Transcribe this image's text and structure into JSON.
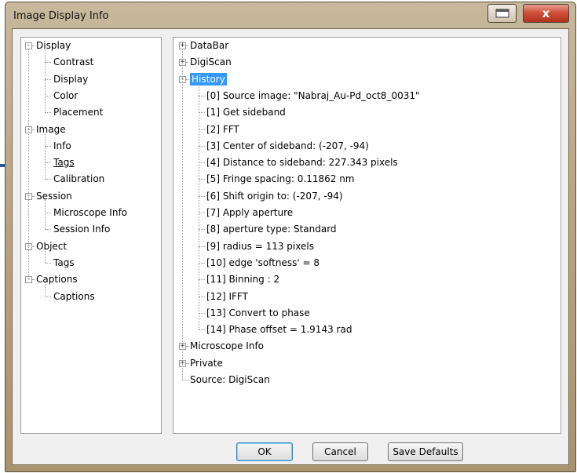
{
  "window": {
    "title": "Image Display Info",
    "close_glyph": "x"
  },
  "left_tree": {
    "sections": [
      {
        "label": "Display",
        "children": [
          "Contrast",
          "Display",
          "Color",
          "Placement"
        ]
      },
      {
        "label": "Image",
        "children": [
          "Info",
          "Tags",
          "Calibration"
        ]
      },
      {
        "label": "Session",
        "children": [
          "Microscope Info",
          "Session Info"
        ]
      },
      {
        "label": "Object",
        "children": [
          "Tags"
        ]
      },
      {
        "label": "Captions",
        "children": [
          "Captions"
        ]
      }
    ]
  },
  "right_tree": {
    "nodes": [
      {
        "label": "DataBar",
        "toggle": "+"
      },
      {
        "label": "DigiScan",
        "toggle": "+"
      },
      {
        "label": "History",
        "toggle": "-"
      },
      {
        "label": "Microscope Info",
        "toggle": "+"
      },
      {
        "label": "Private",
        "toggle": "+"
      },
      {
        "label": "Source: DigiScan"
      }
    ],
    "history_items": [
      "[0] Source image: \"Nabraj_Au-Pd_oct8_0031\"",
      "[1] Get sideband",
      "[2]  FFT",
      "[3]  Center of sideband: (-207, -94)",
      "[4]  Distance to sideband: 227.343 pixels",
      "[5]  Fringe spacing: 0.11862 nm",
      "[6]  Shift origin to: (-207, -94)",
      "[7] Apply aperture",
      "[8]  aperture type: Standard",
      "[9]  radius = 113 pixels",
      "[10]  edge 'softness' = 8",
      "[11] Binning : 2",
      "[12] IFFT",
      "[13] Convert to phase",
      "[14]  Phase offset = 1.9143 rad"
    ]
  },
  "buttons": {
    "ok": "OK",
    "cancel": "Cancel",
    "save_defaults": "Save Defaults"
  },
  "colors": {
    "selection": "#3399ff",
    "arrow": "#2b54a8"
  },
  "icons": [
    "restore-icon",
    "close-icon",
    "arrow-indicator-icon"
  ]
}
